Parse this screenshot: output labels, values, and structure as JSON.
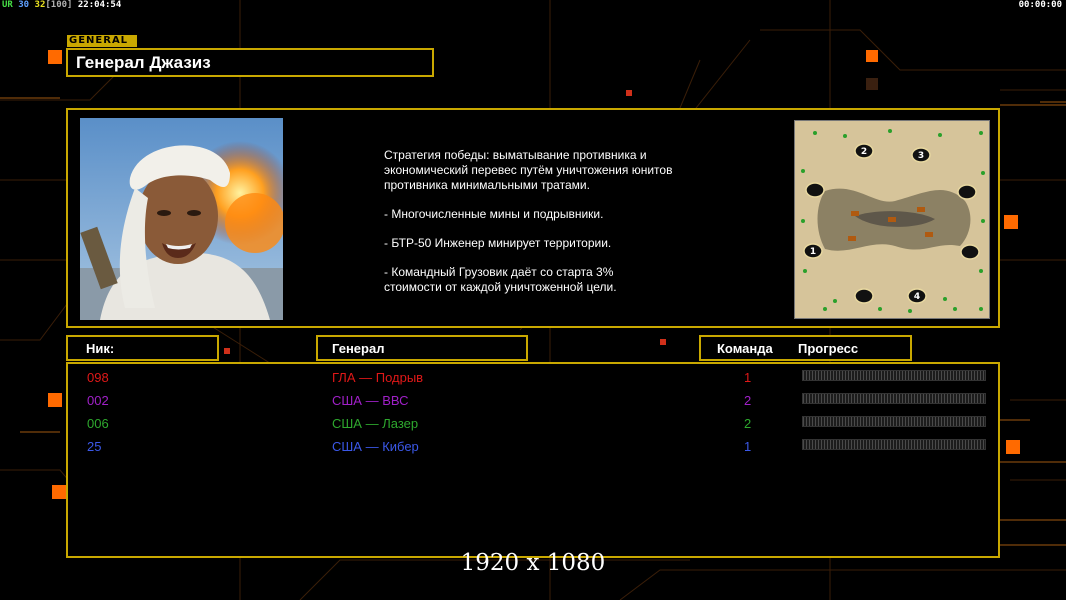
{
  "hud": {
    "tag": "UR",
    "num1": "30",
    "num2": "32",
    "num3": "[100]",
    "clock": "22:04:54",
    "timer": "00:00:00"
  },
  "general_tag": "GENERAL",
  "general_name": "Генерал Джазиз",
  "description": [
    "Стратегия победы: выматывание противника и\n экономический перевес путём уничтожения юнитов\n противника минимальными тратами.",
    "- Многочисленные мины и подрывники.",
    "- БТР-50 Инженер минирует территории.",
    "- Командный Грузовик даёт со старта 3%\n стоимости от каждой уничтоженной цели."
  ],
  "headers": {
    "nick": "Ник:",
    "general": "Генерал",
    "team": "Команда",
    "progress": "Прогресс"
  },
  "players": [
    {
      "nick": "098",
      "general": "ГЛА — Подрыв",
      "team": "1",
      "color": "#e01818",
      "progress": 0
    },
    {
      "nick": "002",
      "general": "США — ВВС",
      "team": "2",
      "color": "#a020c8",
      "progress": 0
    },
    {
      "nick": "006",
      "general": "США — Лазер",
      "team": "2",
      "color": "#2ea82e",
      "progress": 0
    },
    {
      "nick": "25",
      "general": "США — Кибер",
      "team": "1",
      "color": "#3b58e8",
      "progress": 0
    }
  ],
  "map_slots": [
    "1",
    "2",
    "3",
    "4"
  ],
  "resolution": "1920 x 1080",
  "colors": {
    "accent": "#c9a800",
    "orange": "#ff6a00"
  }
}
